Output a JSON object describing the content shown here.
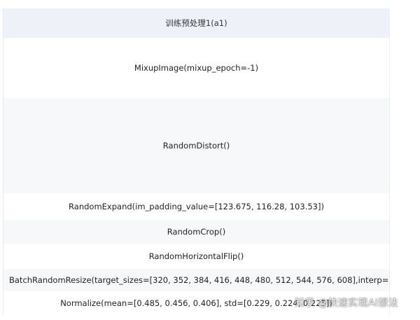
{
  "table": {
    "header": "训练预处理1(a1)",
    "rows": [
      "MixupImage(mixup_epoch=-1)",
      "RandomDistort()",
      "RandomExpand(im_padding_value=[123.675, 116.28, 103.53])",
      "RandomCrop()",
      "RandomHorizontalFlip()",
      "BatchRandomResize(target_sizes=[320, 352, 384, 416, 448, 480, 512, 544, 576, 608],interp='RANDOM'",
      "Normalize(mean=[0.485, 0.456, 0.406], std=[0.229, 0.224, 0.225])"
    ]
  },
  "watermark": {
    "text": "知乎 @快速实现AI想法"
  }
}
